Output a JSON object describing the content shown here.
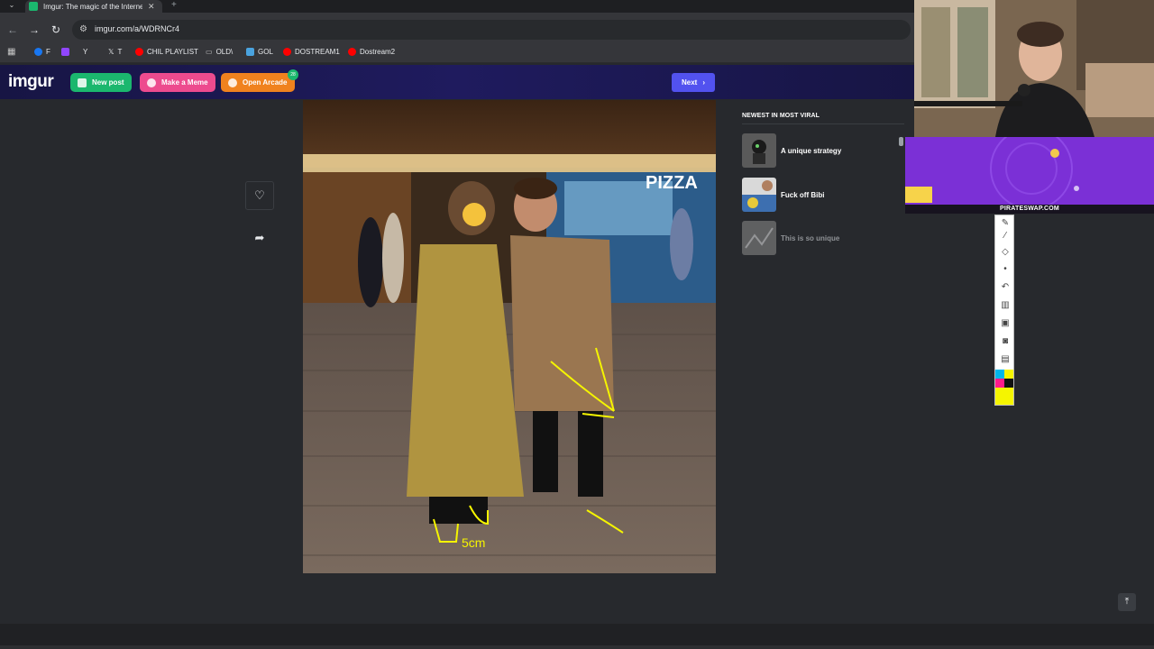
{
  "browser": {
    "tab_title": "Imgur: The magic of the Interne",
    "tab_close": "✕",
    "new_tab": "+",
    "url": "imgur.com/a/WDRNCr4",
    "bookmarks": [
      {
        "label": "F",
        "color": "#1877f2"
      },
      {
        "label": "",
        "color": "#9146ff"
      },
      {
        "label": "Y",
        "color": "#e8eaed"
      },
      {
        "label": "T",
        "color": "#e8eaed"
      },
      {
        "label": "CHIL PLAYLIST",
        "color": "#ff0000"
      },
      {
        "label": "OLD\\",
        "color": "#9aa0a6"
      },
      {
        "label": "GOL",
        "color": "#4aa3df"
      },
      {
        "label": "DOSTREAM1",
        "color": "#ff0000"
      },
      {
        "label": "Dostream2",
        "color": "#ff0000"
      }
    ]
  },
  "imgur": {
    "logo": "imgur",
    "new_post": "New post",
    "make_meme": "Make a Meme",
    "open_arcade": "Open Arcade",
    "arcade_badge": "28",
    "next": "Next",
    "newest_title": "NEWEST IN MOST VIRAL",
    "viral_items": [
      {
        "label": "A unique strategy"
      },
      {
        "label": "Fuck off Bibi"
      },
      {
        "label": "This is so unique"
      }
    ]
  },
  "photo": {
    "sign_pizza": "PIZZA",
    "annotation_text": "5cm"
  },
  "overlay": {
    "banner_text": "PIRATESWAP.COM"
  },
  "colors": {
    "new_post": "#1bb76e",
    "make_meme": "#ed4b8e",
    "open_arcade": "#f0821e",
    "next": "#5252ef",
    "header": "#1b1850",
    "annotation": "#f5f500"
  }
}
